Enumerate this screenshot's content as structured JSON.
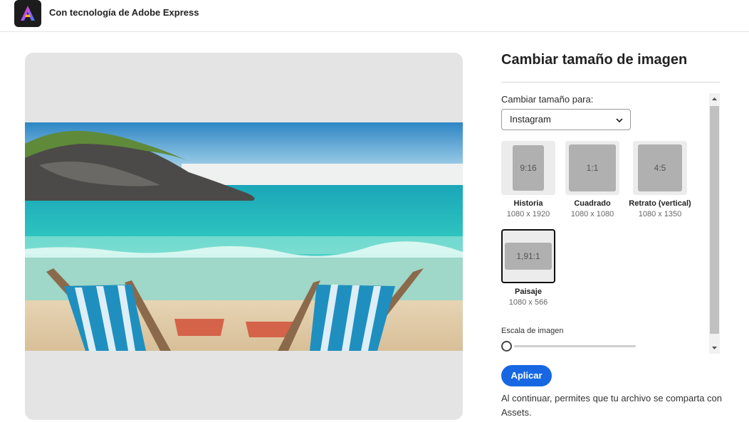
{
  "header": {
    "logo_icon": "adobe-express-logo",
    "powered_by": "Con tecnología de Adobe Express"
  },
  "preview": {
    "image_description_icon": "beach-photo"
  },
  "panel": {
    "title": "Cambiar tamaño de imagen",
    "resize_for_label": "Cambiar tamaño para:",
    "platform_selected": "Instagram",
    "sizes": [
      {
        "ratio": "9:16",
        "name": "Historia",
        "dims": "1080 x 1920",
        "selected": false
      },
      {
        "ratio": "1:1",
        "name": "Cuadrado",
        "dims": "1080 x 1080",
        "selected": false
      },
      {
        "ratio": "4:5",
        "name": "Retrato (vertical)",
        "dims": "1080 x 1350",
        "selected": false
      },
      {
        "ratio": "1,91:1",
        "name": "Paisaje",
        "dims": "1080 x 566",
        "selected": true
      }
    ],
    "scale_label": "Escala de imagen",
    "scale_value": 0,
    "apply_label": "Aplicar",
    "consent_text": "Al continuar, permites que tu archivo se comparta con Assets."
  },
  "colors": {
    "accent": "#1767e2",
    "selected_border": "#111111"
  }
}
